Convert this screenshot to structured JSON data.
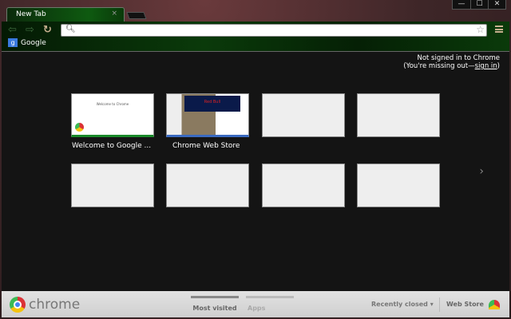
{
  "window": {
    "minimize": "—",
    "maximize": "☐",
    "close": "✕"
  },
  "tab": {
    "title": "New Tab",
    "close": "×"
  },
  "toolbar": {
    "back_icon": "arrow-left",
    "forward_icon": "arrow-right",
    "reload_icon": "reload",
    "omnibox_value": "",
    "star_icon": "star",
    "menu_icon": "hamburger"
  },
  "bookmarks": [
    {
      "label": "Google",
      "icon": "google-g"
    }
  ],
  "signin": {
    "line1": "Not signed in to Chrome",
    "line2_prefix": "(You're missing out—",
    "link": "sign in",
    "line2_suffix": ")"
  },
  "tiles": [
    {
      "label": "Welcome to Google ...",
      "thumb_title": "Welcome to Chrome"
    },
    {
      "label": "Chrome Web Store",
      "thumb_title": "Red Bull"
    },
    {
      "label": ""
    },
    {
      "label": ""
    },
    {
      "label": ""
    },
    {
      "label": ""
    },
    {
      "label": ""
    },
    {
      "label": ""
    }
  ],
  "next_page": "›",
  "footer": {
    "logo_text": "chrome",
    "tabs": [
      {
        "label": "Most visited",
        "active": true
      },
      {
        "label": "Apps",
        "active": false
      }
    ],
    "recently_closed": "Recently closed ▾",
    "web_store": "Web Store"
  }
}
